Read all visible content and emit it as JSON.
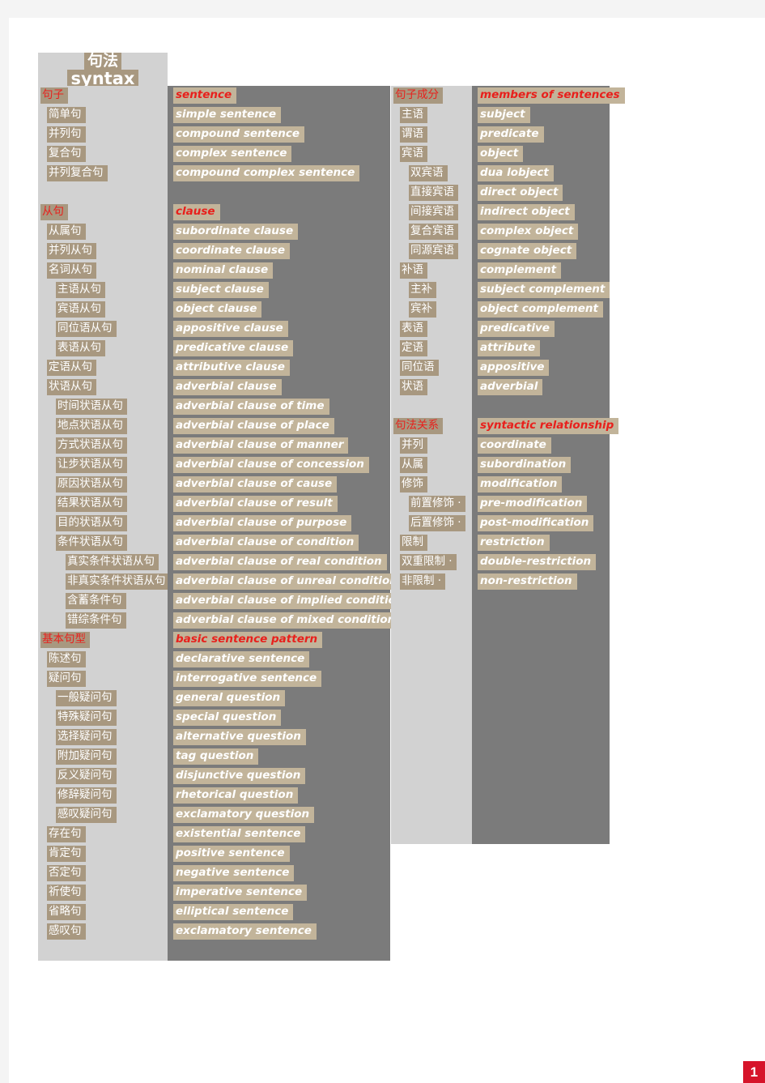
{
  "page": {
    "title_cn": "句法",
    "title_en": "syntax",
    "page_number": "1",
    "colors": {
      "page_background": "#ffffff",
      "outer_background": "#f4f4f4",
      "chinese_column_background": "#d2d2d2",
      "english_column_background": "#7b7b7b",
      "chinese_highlight": "#a89880",
      "english_highlight": "#c2b49a",
      "heading_text": "#e8201c",
      "body_text": "#ffffff",
      "page_number_badge": "#d6142a"
    }
  },
  "left_table": {
    "rows": [
      {
        "cn": "句子",
        "en": "sentence",
        "indent": 0,
        "heading": true
      },
      {
        "cn": "简单句",
        "en": "simple sentence",
        "indent": 1,
        "heading": false
      },
      {
        "cn": "并列句",
        "en": "compound sentence",
        "indent": 1,
        "heading": false
      },
      {
        "cn": "复合句",
        "en": "complex sentence",
        "indent": 1,
        "heading": false
      },
      {
        "cn": "并列复合句",
        "en": "compound complex sentence",
        "indent": 1,
        "heading": false
      },
      {
        "cn": "",
        "en": "",
        "indent": 0,
        "heading": false,
        "spacer": true
      },
      {
        "cn": "从句",
        "en": "clause",
        "indent": 0,
        "heading": true
      },
      {
        "cn": "从属句",
        "en": "subordinate clause",
        "indent": 1,
        "heading": false
      },
      {
        "cn": "并列从句",
        "en": "coordinate clause",
        "indent": 1,
        "heading": false
      },
      {
        "cn": "名词从句",
        "en": "nominal clause",
        "indent": 1,
        "heading": false
      },
      {
        "cn": "主语从句",
        "en": "subject clause",
        "indent": 2,
        "heading": false
      },
      {
        "cn": "宾语从句",
        "en": "object clause",
        "indent": 2,
        "heading": false
      },
      {
        "cn": "同位语从句",
        "en": "appositive clause",
        "indent": 2,
        "heading": false
      },
      {
        "cn": "表语从句",
        "en": "predicative clause",
        "indent": 2,
        "heading": false
      },
      {
        "cn": "定语从句",
        "en": "attributive clause",
        "indent": 1,
        "heading": false
      },
      {
        "cn": "状语从句",
        "en": "adverbial clause",
        "indent": 1,
        "heading": false
      },
      {
        "cn": "时间状语从句",
        "en": "adverbial clause of time",
        "indent": 2,
        "heading": false
      },
      {
        "cn": "地点状语从句",
        "en": "adverbial clause of place",
        "indent": 2,
        "heading": false
      },
      {
        "cn": "方式状语从句",
        "en": "adverbial clause of manner",
        "indent": 2,
        "heading": false
      },
      {
        "cn": "让步状语从句",
        "en": "adverbial clause of concession",
        "indent": 2,
        "heading": false
      },
      {
        "cn": "原因状语从句",
        "en": "adverbial clause of cause",
        "indent": 2,
        "heading": false
      },
      {
        "cn": "结果状语从句",
        "en": "adverbial clause of result",
        "indent": 2,
        "heading": false
      },
      {
        "cn": "目的状语从句",
        "en": "adverbial clause of purpose",
        "indent": 2,
        "heading": false
      },
      {
        "cn": "条件状语从句",
        "en": "adverbial clause of condition",
        "indent": 2,
        "heading": false
      },
      {
        "cn": "真实条件状语从句",
        "en": "adverbial clause of   real condition",
        "indent": 3,
        "heading": false
      },
      {
        "cn": "非真实条件状语从句",
        "en": "adverbial clause of unreal condition",
        "indent": 3,
        "heading": false
      },
      {
        "cn": "含蓄条件句",
        "en": "adverbial clause of implied condition",
        "indent": 3,
        "heading": false
      },
      {
        "cn": "错综条件句",
        "en": "adverbial clause of mixed condition",
        "indent": 3,
        "heading": false
      },
      {
        "cn": "基本句型",
        "en": "basic sentence pattern",
        "indent": 0,
        "heading": true
      },
      {
        "cn": "陈述句",
        "en": "declarative sentence",
        "indent": 1,
        "heading": false
      },
      {
        "cn": "疑问句",
        "en": "interrogative sentence",
        "indent": 1,
        "heading": false
      },
      {
        "cn": "一般疑问句",
        "en": "general question",
        "indent": 2,
        "heading": false
      },
      {
        "cn": "特殊疑问句",
        "en": "special question",
        "indent": 2,
        "heading": false
      },
      {
        "cn": "选择疑问句",
        "en": "alternative question",
        "indent": 2,
        "heading": false
      },
      {
        "cn": "附加疑问句",
        "en": "tag question",
        "indent": 2,
        "heading": false
      },
      {
        "cn": "反义疑问句",
        "en": "disjunctive question",
        "indent": 2,
        "heading": false
      },
      {
        "cn": "修辞疑问句",
        "en": "rhetorical question",
        "indent": 2,
        "heading": false
      },
      {
        "cn": "感叹疑问句",
        "en": "exclamatory question",
        "indent": 2,
        "heading": false
      },
      {
        "cn": "存在句",
        "en": "existential sentence",
        "indent": 1,
        "heading": false
      },
      {
        "cn": "肯定句",
        "en": "positive sentence",
        "indent": 1,
        "heading": false
      },
      {
        "cn": "否定句",
        "en": "negative sentence",
        "indent": 1,
        "heading": false
      },
      {
        "cn": "祈使句",
        "en": "imperative sentence",
        "indent": 1,
        "heading": false
      },
      {
        "cn": "省略句",
        "en": "elliptical sentence",
        "indent": 1,
        "heading": false
      },
      {
        "cn": "感叹句",
        "en": "exclamatory sentence",
        "indent": 1,
        "heading": false
      },
      {
        "cn": "",
        "en": "",
        "indent": 0,
        "heading": false,
        "spacer": true
      }
    ]
  },
  "right_table": {
    "rows": [
      {
        "cn": "句子成分",
        "en": "members of sentences",
        "indent": 0,
        "heading": true
      },
      {
        "cn": "主语",
        "en": "subject",
        "indent": 1,
        "heading": false
      },
      {
        "cn": "谓语",
        "en": "predicate",
        "indent": 1,
        "heading": false
      },
      {
        "cn": "宾语",
        "en": "object",
        "indent": 1,
        "heading": false
      },
      {
        "cn": "双宾语",
        "en": "dua lobject",
        "indent": 2,
        "heading": false
      },
      {
        "cn": "直接宾语",
        "en": "direct object",
        "indent": 2,
        "heading": false
      },
      {
        "cn": "间接宾语",
        "en": "indirect object",
        "indent": 2,
        "heading": false
      },
      {
        "cn": "复合宾语",
        "en": "complex object",
        "indent": 2,
        "heading": false
      },
      {
        "cn": "同源宾语",
        "en": "cognate object",
        "indent": 2,
        "heading": false
      },
      {
        "cn": "补语",
        "en": "complement",
        "indent": 1,
        "heading": false
      },
      {
        "cn": "主补",
        "en": "subject complement",
        "indent": 2,
        "heading": false
      },
      {
        "cn": "宾补",
        "en": "object complement",
        "indent": 2,
        "heading": false
      },
      {
        "cn": "表语",
        "en": "predicative",
        "indent": 1,
        "heading": false
      },
      {
        "cn": "定语",
        "en": "attribute",
        "indent": 1,
        "heading": false
      },
      {
        "cn": "同位语",
        "en": "appositive",
        "indent": 1,
        "heading": false
      },
      {
        "cn": "状语",
        "en": "adverbial",
        "indent": 1,
        "heading": false
      },
      {
        "cn": "",
        "en": "",
        "indent": 0,
        "heading": false,
        "spacer": true
      },
      {
        "cn": "句法关系",
        "en": "syntactic relationship",
        "indent": 0,
        "heading": true
      },
      {
        "cn": "并列",
        "en": "coordinate",
        "indent": 1,
        "heading": false
      },
      {
        "cn": "从属",
        "en": "subordination",
        "indent": 1,
        "heading": false
      },
      {
        "cn": "修饰",
        "en": "modification",
        "indent": 1,
        "heading": false
      },
      {
        "cn": "前置修饰 ·",
        "en": "pre-modification",
        "indent": 2,
        "heading": false
      },
      {
        "cn": "后置修饰 ·",
        "en": "post-modification",
        "indent": 2,
        "heading": false
      },
      {
        "cn": "限制",
        "en": "restriction",
        "indent": 1,
        "heading": false
      },
      {
        "cn": "双重限制 ·",
        "en": "double-restriction",
        "indent": 1,
        "heading": false
      },
      {
        "cn": "非限制 ·",
        "en": "non-restriction",
        "indent": 1,
        "heading": false
      },
      {
        "cn": "",
        "en": "",
        "indent": 0,
        "heading": false,
        "spacer": true
      },
      {
        "cn": "",
        "en": "",
        "indent": 0,
        "heading": false,
        "spacer": true
      },
      {
        "cn": "",
        "en": "",
        "indent": 0,
        "heading": false,
        "spacer": true
      },
      {
        "cn": "",
        "en": "",
        "indent": 0,
        "heading": false,
        "spacer": true
      },
      {
        "cn": "",
        "en": "",
        "indent": 0,
        "heading": false,
        "spacer": true
      },
      {
        "cn": "",
        "en": "",
        "indent": 0,
        "heading": false,
        "spacer": true
      },
      {
        "cn": "",
        "en": "",
        "indent": 0,
        "heading": false,
        "spacer": true
      },
      {
        "cn": "",
        "en": "",
        "indent": 0,
        "heading": false,
        "spacer": true
      },
      {
        "cn": "",
        "en": "",
        "indent": 0,
        "heading": false,
        "spacer": true
      },
      {
        "cn": "",
        "en": "",
        "indent": 0,
        "heading": false,
        "spacer": true
      },
      {
        "cn": "",
        "en": "",
        "indent": 0,
        "heading": false,
        "spacer": true
      },
      {
        "cn": "",
        "en": "",
        "indent": 0,
        "heading": false,
        "spacer": true
      },
      {
        "cn": "",
        "en": "",
        "indent": 0,
        "heading": false,
        "spacer": true
      }
    ]
  }
}
